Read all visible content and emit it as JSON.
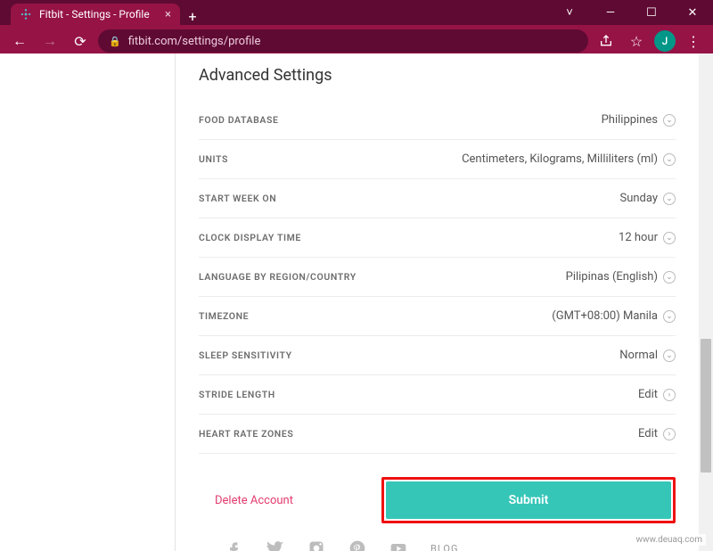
{
  "window": {
    "title": "Fitbit - Settings - Profile"
  },
  "browser": {
    "url": "fitbit.com/settings/profile",
    "avatar_initial": "J"
  },
  "page": {
    "section_title": "Advanced Settings",
    "rows": [
      {
        "label": "FOOD DATABASE",
        "value": "Philippines"
      },
      {
        "label": "UNITS",
        "value": "Centimeters, Kilograms, Milliliters (ml)"
      },
      {
        "label": "START WEEK ON",
        "value": "Sunday"
      },
      {
        "label": "CLOCK DISPLAY TIME",
        "value": "12 hour"
      },
      {
        "label": "LANGUAGE BY REGION/COUNTRY",
        "value": "Pilipinas (English)"
      },
      {
        "label": "TIMEZONE",
        "value": "(GMT+08:00) Manila"
      },
      {
        "label": "SLEEP SENSITIVITY",
        "value": "Normal"
      },
      {
        "label": "STRIDE LENGTH",
        "value": "Edit"
      },
      {
        "label": "HEART RATE ZONES",
        "value": "Edit"
      }
    ],
    "delete_label": "Delete Account",
    "submit_label": "Submit",
    "blog_label": "BLOG"
  },
  "watermark": "www.deuaq.com"
}
